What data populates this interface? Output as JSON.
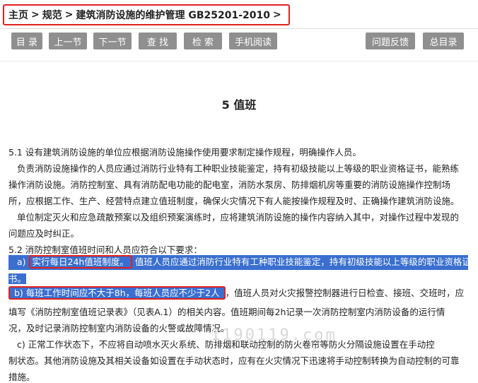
{
  "breadcrumb": {
    "home": "主页",
    "sep1": ">",
    "spec": "规范",
    "sep2": ">",
    "current": "建筑消防设施的维护管理 GB25201-2010",
    "sep3": ">"
  },
  "toolbar": {
    "toc": "目 录",
    "prev": "上一节",
    "next": "下一节",
    "find": "查 找",
    "search": "检 索",
    "mobile": "手机阅读",
    "feedback": "问题反馈",
    "index": "总目录"
  },
  "article": {
    "title": "5 值班",
    "p1": "5.1 设有建筑消防设施的单位应根据消防设施操作使用要求制定操作规程，明确操作人员。",
    "p2a": "负责消防设施操作的人员应通过消防行业特有工种职业技能鉴定，持有初级技能以上等级的职业资格证书，能熟练",
    "p2b": "操作消防设施。消防控制室、具有消防配电功能的配电室，消防水泵房、防排烟机房等重要的消防设施操作控制场",
    "p2c": "所，应根据工作、生产、经营特点建立值班制度，确保火灾情况下有人能按操作规程及时、正确操作建筑消防设施。",
    "p3a": "单位制定灭火和应急疏散预案以及组织预案演练时，应将建筑消防设施的操作内容纳入其中，对操作过程中发现的",
    "p3b": "问题应及时纠正。",
    "p4": "5.2 消防控制室值班时间和人员应符合以下要求：",
    "a_label": "a)",
    "a_box": "实行每日24h值班制度。",
    "a_rest": "值班人员应通过消防行业特有工种职业技能鉴定，持有初级技能以上等级的职业资格证",
    "a_end": "书。",
    "b_box": "b) 每班工作时间应不大于8h，每班人员应不少于2人",
    "b_rest": "，值班人员对火灾报警控制器进行日检查、接班、交班时，应",
    "b2": "填写《消防控制室值班记录表》（见表A.1）的相关内容。值班期间每2h记录一次消防控制室内消防设备的运行情",
    "b3": "况，及时记录消防控制室内消防设备的火警或故障情况。",
    "c1": "c) 正常工作状态下，不应将自动喷水灭火系统、防排烟和联动控制的防火卷帘等防火分隔设施设置在手动控",
    "c2": "制状态。其他消防设施及其相关设备如设置在手动状态时，应有在火灾情况下迅速将手动控制转换为自动控制的可靠",
    "c3": "措施。",
    "watermark": "1190119.com"
  },
  "colors": {
    "highlight": "#3a6fd0",
    "annotation": "#e02020",
    "button": "#8f8f8f"
  }
}
